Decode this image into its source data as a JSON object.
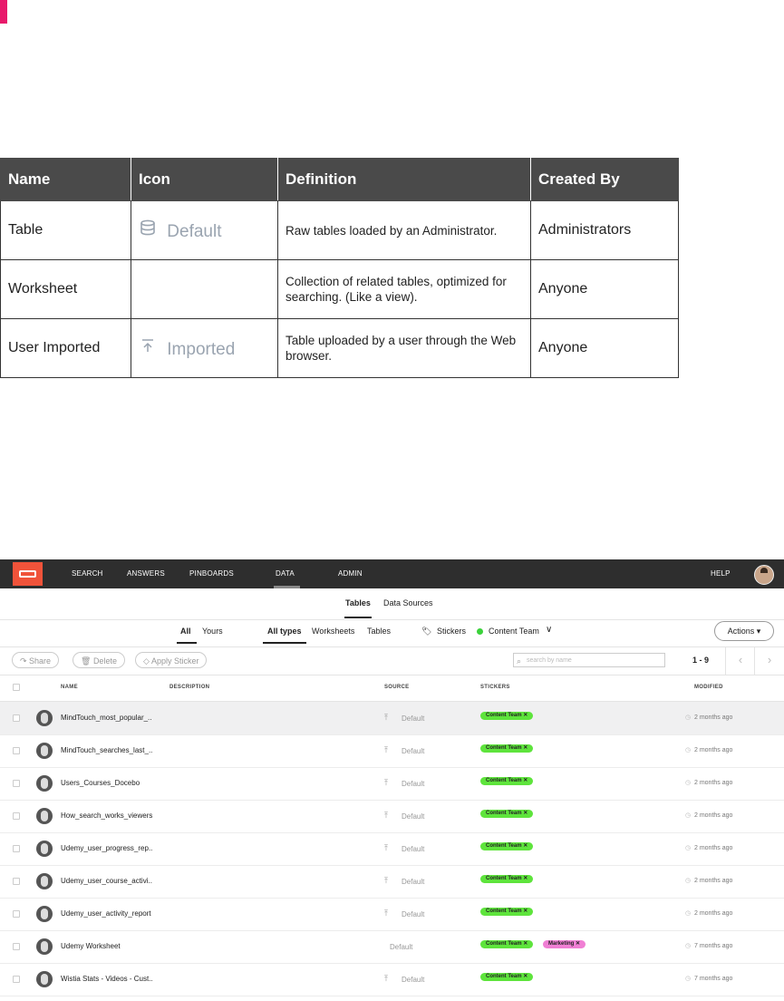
{
  "ref_table": {
    "headers": [
      "Name",
      "Icon",
      "Definition",
      "Created By"
    ],
    "rows": [
      {
        "name": "Table",
        "icon_name": "database-icon",
        "icon_label": "Default",
        "definition": "Raw tables loaded by an Administrator.",
        "created_by": "Administrators"
      },
      {
        "name": "Worksheet",
        "icon_name": "",
        "icon_label": "",
        "definition": "Collection of related tables, optimized for searching. (Like a view).",
        "created_by": "Anyone"
      },
      {
        "name": "User Imported",
        "icon_name": "upload-icon",
        "icon_label": "Imported",
        "definition": "Table uploaded by a user through the Web browser.",
        "created_by": "Anyone"
      }
    ]
  },
  "app": {
    "nav": {
      "items": [
        "SEARCH",
        "ANSWERS",
        "PINBOARDS",
        "DATA",
        "ADMIN"
      ],
      "help": "HELP",
      "active": "DATA"
    },
    "subtabs": [
      "Tables",
      "Data Sources"
    ],
    "filters": {
      "owner": [
        "All",
        "Yours"
      ],
      "types": [
        "All types",
        "Worksheets",
        "Tables"
      ],
      "stickers_label": "Stickers",
      "sticker_selected": "Content Team",
      "actions": "Actions ▾"
    },
    "toolbar": {
      "share": "Share",
      "delete": "Delete",
      "apply_sticker": "Apply Sticker",
      "search_placeholder": "search by name",
      "range": "1 - 9"
    },
    "columns": {
      "name": "NAME",
      "description": "DESCRIPTION",
      "source": "SOURCE",
      "stickers": "STICKERS",
      "modified": "MODIFIED"
    },
    "rows": [
      {
        "name": "MindTouch_most_popular_..",
        "source": "Default",
        "stickers": [
          "Content Team"
        ],
        "modified": "2 months ago"
      },
      {
        "name": "MindTouch_searches_last_..",
        "source": "Default",
        "stickers": [
          "Content Team"
        ],
        "modified": "2 months ago"
      },
      {
        "name": "Users_Courses_Docebo",
        "source": "Default",
        "stickers": [
          "Content Team"
        ],
        "modified": "2 months ago"
      },
      {
        "name": "How_search_works_viewers",
        "source": "Default",
        "stickers": [
          "Content Team"
        ],
        "modified": "2 months ago"
      },
      {
        "name": "Udemy_user_progress_rep..",
        "source": "Default",
        "stickers": [
          "Content Team"
        ],
        "modified": "2 months ago"
      },
      {
        "name": "Udemy_user_course_activi..",
        "source": "Default",
        "stickers": [
          "Content Team"
        ],
        "modified": "2 months ago"
      },
      {
        "name": "Udemy_user_activity_report",
        "source": "Default",
        "stickers": [
          "Content Team"
        ],
        "modified": "2 months ago"
      },
      {
        "name": "Udemy Worksheet",
        "source": "Default",
        "stickers": [
          "Content Team",
          "Marketing"
        ],
        "modified": "7 months ago"
      },
      {
        "name": "Wistia Stats - Videos - Cust..",
        "source": "Default",
        "stickers": [
          "Content Team"
        ],
        "modified": "7 months ago"
      }
    ],
    "colors": {
      "sticker_content_team": "#5ee43c",
      "sticker_marketing": "#f07fd4",
      "logo": "#f0533a",
      "nav_bg": "#2e2e2e"
    }
  }
}
